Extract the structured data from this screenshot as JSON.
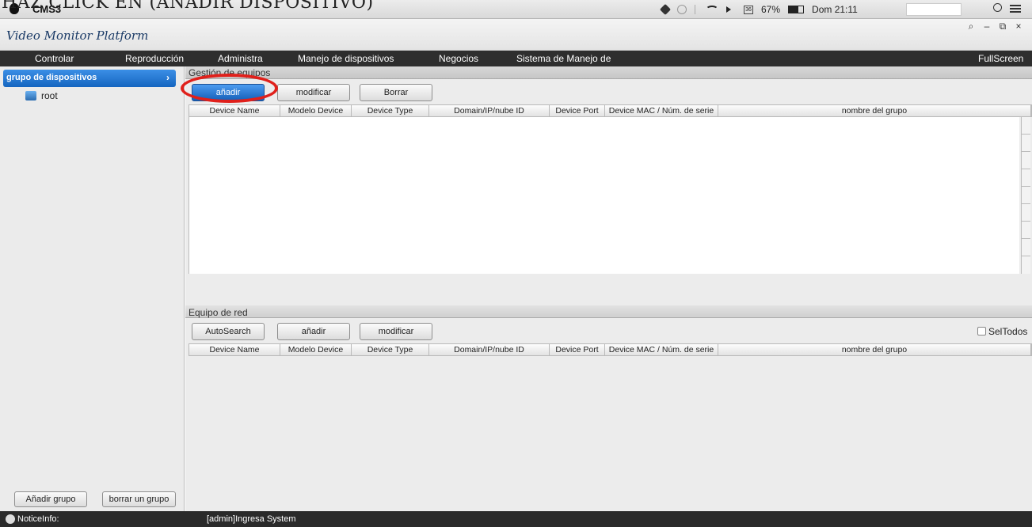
{
  "caption": "HAZ CLICK EN (AÑADIR DISPOSITIVO)",
  "mac_menubar": {
    "app_name": "CMS3",
    "battery": "67%",
    "clock": "Dom 21:11",
    "calendar_day": "36"
  },
  "window": {
    "logo": "Video Monitor Platform",
    "controls": [
      "⌕",
      "–",
      "⧉",
      "×"
    ]
  },
  "menu": {
    "items": [
      "Controlar",
      "Reproducción",
      "Administra",
      "Manejo de dispositivos",
      "Negocios",
      "Sistema de Manejo de"
    ],
    "fullscreen": "FullScreen"
  },
  "sidebar": {
    "header": "grupo de dispositivos",
    "arrow": "›",
    "root": "root",
    "add_group": "Añadir grupo",
    "delete_group": "borrar un grupo"
  },
  "gestion": {
    "title": "Gestión de equipos",
    "buttons": [
      "añadir",
      "modificar",
      "Borrar"
    ]
  },
  "red": {
    "title": "Equipo de red",
    "buttons": [
      "AutoSearch",
      "añadir",
      "modificar"
    ],
    "select_all": "SelTodos"
  },
  "columns": [
    "Device Name",
    "Modelo Device",
    "Device Type",
    "Domain/IP/nube ID",
    "Device Port",
    "Device MAC / Núm. de serie",
    "nombre del grupo"
  ],
  "status": {
    "notice": "NoticeInfo:",
    "message": "[admin]Ingresa System"
  },
  "colors": {
    "active_button": "#1565c0",
    "highlight_circle": "#e0201b",
    "menu_bg": "#2e2e2e"
  }
}
